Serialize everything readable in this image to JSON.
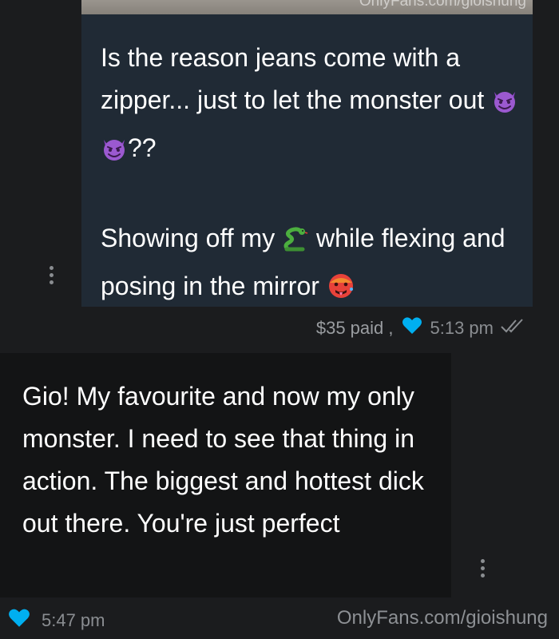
{
  "sent_message": {
    "media_watermark": "OnlyFans.com/gioishung",
    "line1": "Is the reason jeans come with a zipper... just to let the monster out",
    "line1_suffix": "??",
    "line2": "Showing off my",
    "line2_suffix": "while flexing and posing in the mirror",
    "price": "$35 paid ,",
    "time": "5:13 pm"
  },
  "received_message": {
    "text": "Gio! My favourite and now my only monster. I need to see that thing in action. The biggest and hottest dick out there. You're just perfect",
    "time": "5:47 pm"
  },
  "footer": {
    "watermark": "OnlyFans.com/gioishung"
  },
  "colors": {
    "background": "#1b1c1e",
    "sent_bubble": "#202a35",
    "received_bubble": "#131415",
    "heart": "#00aff0",
    "meta_text": "#8a8d91"
  },
  "icons": {
    "emoji_devil": "smiling-imp",
    "emoji_snake": "snake",
    "emoji_hot_face": "hot-face",
    "like": "heart",
    "read_receipt": "double-check",
    "menu": "vertical-ellipsis"
  }
}
